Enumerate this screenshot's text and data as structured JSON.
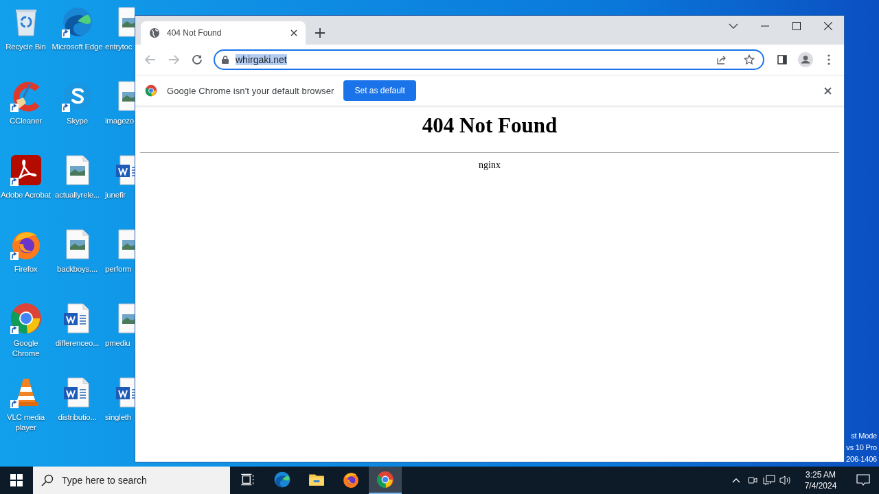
{
  "desktop_icons": [
    {
      "label": "Recycle Bin",
      "kind": "recycle-bin",
      "shortcut": false
    },
    {
      "label": "Microsoft Edge",
      "kind": "edge",
      "shortcut": true
    },
    {
      "label": "entrytoc",
      "kind": "image-file",
      "shortcut": false
    },
    {
      "label": "CCleaner",
      "kind": "ccleaner",
      "shortcut": true
    },
    {
      "label": "Skype",
      "kind": "skype",
      "shortcut": true
    },
    {
      "label": "imagezo",
      "kind": "image-file",
      "shortcut": false
    },
    {
      "label": "Adobe Acrobat",
      "kind": "acrobat",
      "shortcut": true
    },
    {
      "label": "actuallyrele...",
      "kind": "image-file",
      "shortcut": false
    },
    {
      "label": "junefir",
      "kind": "word-file",
      "shortcut": false
    },
    {
      "label": "Firefox",
      "kind": "firefox",
      "shortcut": true
    },
    {
      "label": "backboys....",
      "kind": "image-file",
      "shortcut": false
    },
    {
      "label": "perform",
      "kind": "image-file",
      "shortcut": false
    },
    {
      "label": "Google Chrome",
      "kind": "chrome",
      "shortcut": true
    },
    {
      "label": "differenceo...",
      "kind": "word-file",
      "shortcut": false
    },
    {
      "label": "pmediu",
      "kind": "image-file",
      "shortcut": false
    },
    {
      "label": "VLC media player",
      "kind": "vlc",
      "shortcut": true
    },
    {
      "label": "distributio...",
      "kind": "word-file",
      "shortcut": false
    },
    {
      "label": "singleth",
      "kind": "word-file",
      "shortcut": false
    }
  ],
  "browser": {
    "tabs": [
      {
        "title": "404 Not Found",
        "selected": true
      }
    ],
    "nav_buttons": [
      {
        "kind": "back",
        "disabled": true
      },
      {
        "kind": "forward",
        "disabled": true
      },
      {
        "kind": "reload",
        "disabled": false
      }
    ],
    "address": {
      "text": "whirgaki.net",
      "selected": true
    },
    "infobar": {
      "message": "Google Chrome isn't your default browser",
      "button": "Set as default"
    },
    "page": {
      "heading": "404 Not Found",
      "footer": "nginx"
    }
  },
  "desktop_notice": [
    "st Mode",
    "vs 10 Pro",
    "206-1406"
  ],
  "taskbar": {
    "search_placeholder": "Type here to search",
    "apps": [
      {
        "kind": "task-view",
        "active": false
      },
      {
        "kind": "edge",
        "active": false
      },
      {
        "kind": "explorer",
        "active": false
      },
      {
        "kind": "firefox",
        "active": false
      },
      {
        "kind": "chrome",
        "active": true
      }
    ],
    "time": "3:25 AM",
    "date": "7/4/2024"
  }
}
